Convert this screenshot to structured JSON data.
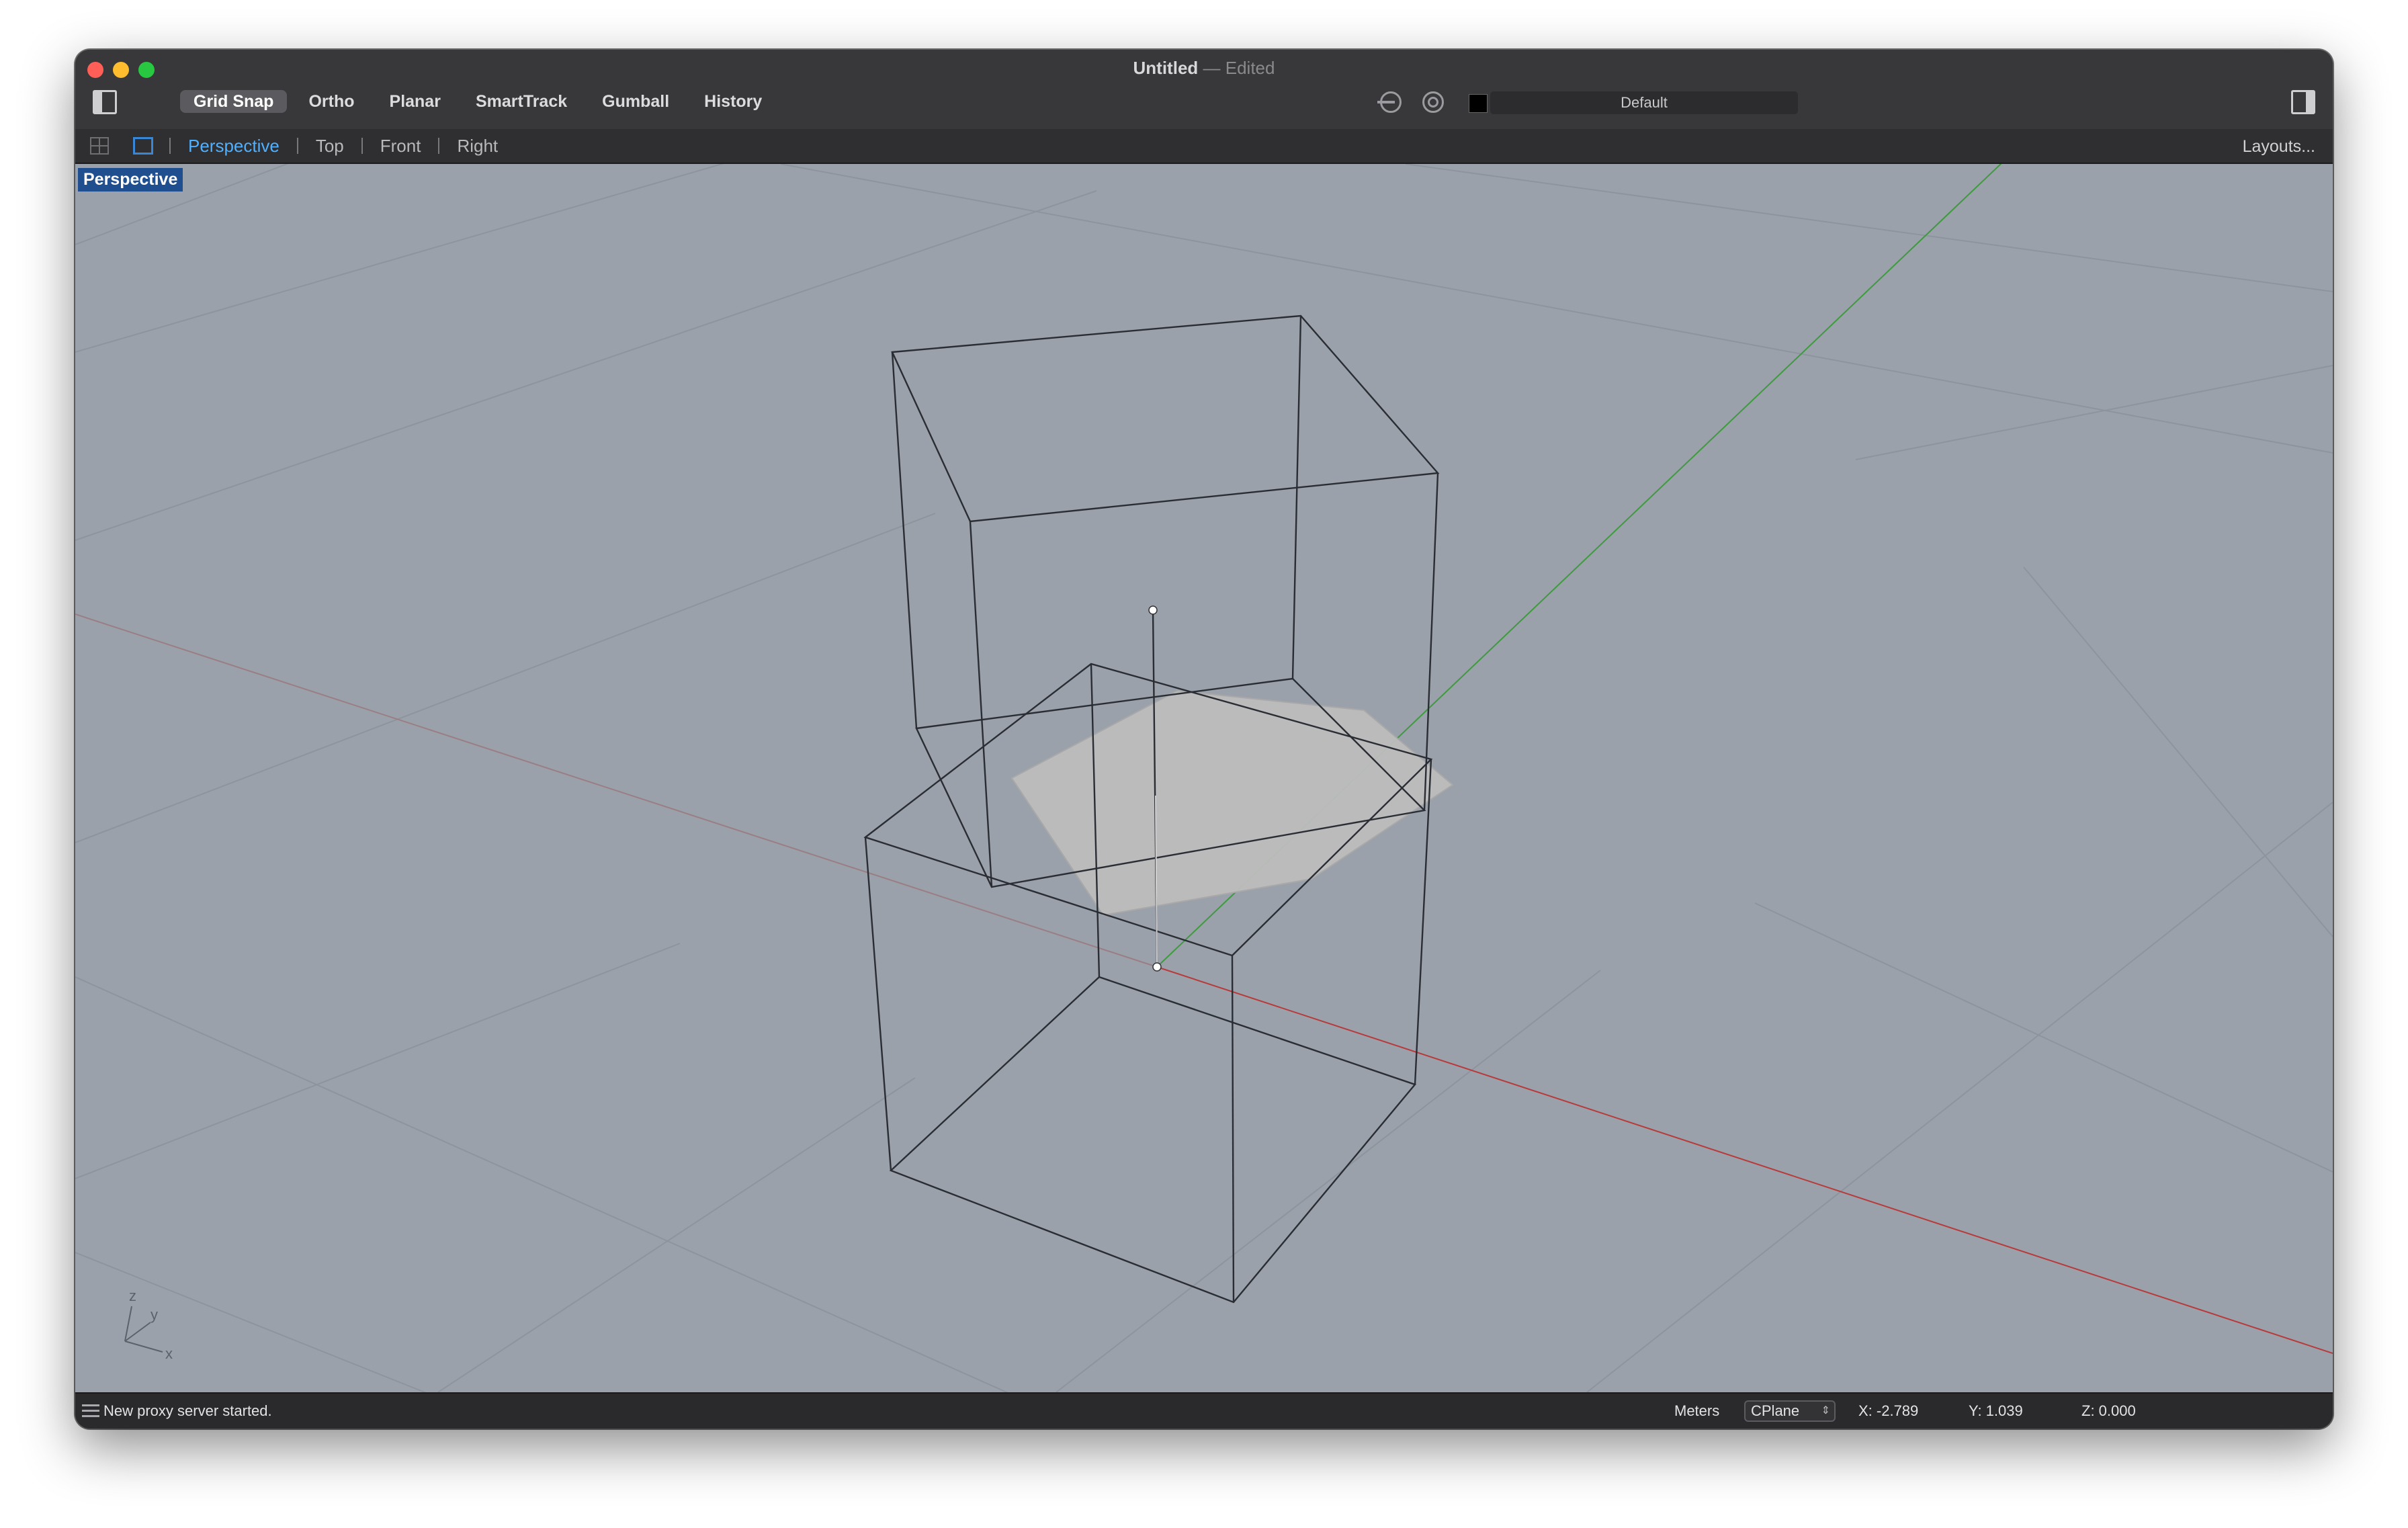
{
  "window": {
    "title": "Untitled",
    "title_separator": "—",
    "title_status": "Edited"
  },
  "toolbar": {
    "modes": [
      {
        "label": "Grid Snap",
        "active": true
      },
      {
        "label": "Ortho",
        "active": false
      },
      {
        "label": "Planar",
        "active": false
      },
      {
        "label": "SmartTrack",
        "active": false
      },
      {
        "label": "Gumball",
        "active": false
      },
      {
        "label": "History",
        "active": false
      }
    ],
    "icons": [
      "osnap-icon",
      "record-history-icon"
    ],
    "layer": {
      "name": "Default",
      "color": "#000000"
    }
  },
  "viewport_tabs": {
    "tabs": [
      "Perspective",
      "Top",
      "Front",
      "Right"
    ],
    "active": "Perspective",
    "layouts_label": "Layouts..."
  },
  "viewport": {
    "label": "Perspective",
    "background": "#9aa1aa",
    "axes_widget": {
      "z": "z",
      "y": "y",
      "x": "x"
    },
    "x_axis_color": "#b83a3a",
    "y_axis_color": "#3f9a3f"
  },
  "status_bar": {
    "message": "New proxy server started.",
    "units": "Meters",
    "cplane": "CPlane",
    "x": "X: -2.789",
    "y": "Y: 1.039",
    "z": "Z: 0.000"
  }
}
